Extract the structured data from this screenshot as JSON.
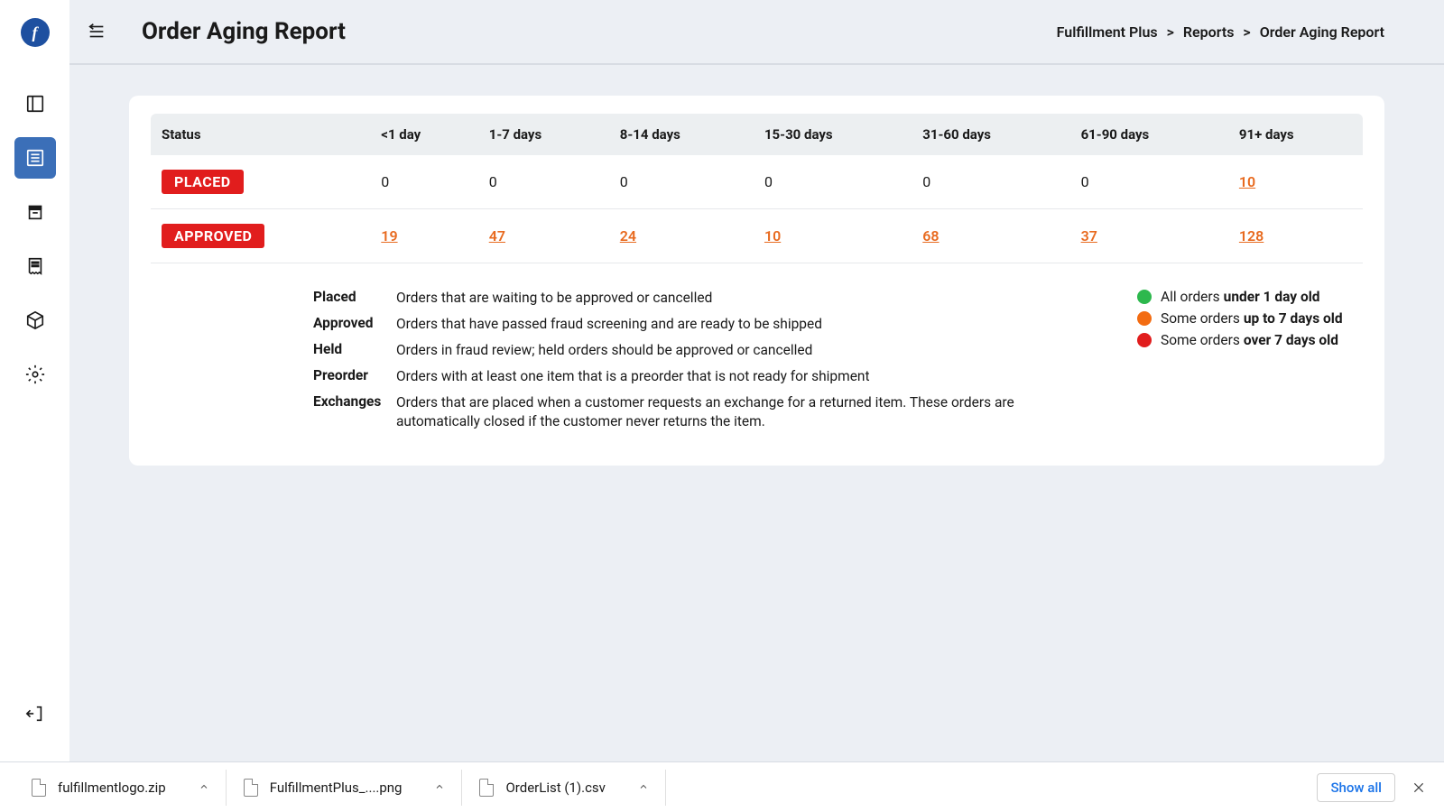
{
  "logo_letter": "f",
  "page_title": "Order Aging Report",
  "breadcrumb": {
    "root": "Fulfillment Plus",
    "mid": "Reports",
    "current": "Order Aging Report",
    "sep": ">"
  },
  "table": {
    "headers": [
      "Status",
      "<1 day",
      "1-7 days",
      "8-14 days",
      "15-30 days",
      "31-60 days",
      "61-90 days",
      "91+ days"
    ],
    "rows": [
      {
        "status": "PLACED",
        "cells": [
          "0",
          "0",
          "0",
          "0",
          "0",
          "0",
          "10"
        ],
        "links": [
          false,
          false,
          false,
          false,
          false,
          false,
          true
        ]
      },
      {
        "status": "APPROVED",
        "cells": [
          "19",
          "47",
          "24",
          "10",
          "68",
          "37",
          "128"
        ],
        "links": [
          true,
          true,
          true,
          true,
          true,
          true,
          true
        ]
      }
    ]
  },
  "definitions": [
    {
      "term": "Placed",
      "desc": "Orders that are waiting to be approved or cancelled"
    },
    {
      "term": "Approved",
      "desc": "Orders that have passed fraud screening and are ready to be shipped"
    },
    {
      "term": "Held",
      "desc": "Orders in fraud review; held orders should be approved or cancelled"
    },
    {
      "term": "Preorder",
      "desc": "Orders with at least one item that is a preorder that is not ready for shipment"
    },
    {
      "term": "Exchanges",
      "desc": "Orders that are placed when a customer requests an exchange for a returned item. These orders are automatically closed if the customer never returns the item."
    }
  ],
  "color_legend": [
    {
      "color": "green",
      "prefix": "All orders",
      "bold": "under 1 day old"
    },
    {
      "color": "orange",
      "prefix": "Some orders",
      "bold": "up to 7 days old"
    },
    {
      "color": "red",
      "prefix": "Some orders",
      "bold": "over 7 days old"
    }
  ],
  "downloads": [
    {
      "name": "fulfillmentlogo.zip",
      "type": "zip"
    },
    {
      "name": "FulfillmentPlus_....png",
      "type": "png"
    },
    {
      "name": "OrderList (1).csv",
      "type": "csv"
    }
  ],
  "show_all": "Show all"
}
